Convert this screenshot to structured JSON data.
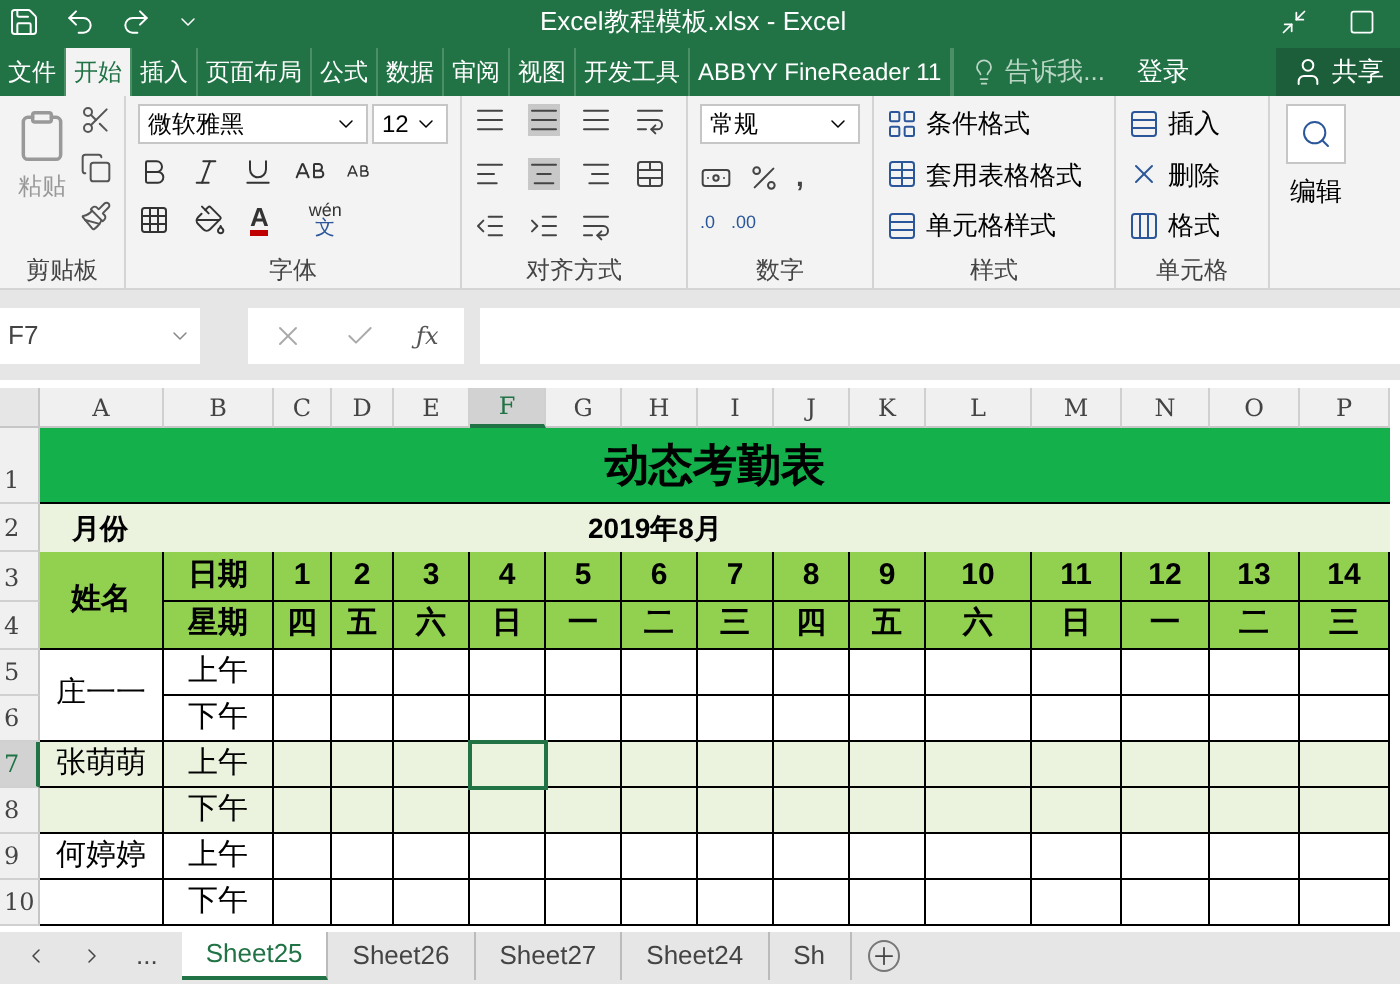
{
  "window": {
    "title": "Excel教程模板.xlsx - Excel"
  },
  "menu_tabs": [
    {
      "label": "文件",
      "selected": false
    },
    {
      "label": "开始",
      "selected": true
    },
    {
      "label": "插入",
      "selected": false
    },
    {
      "label": "页面布局",
      "selected": false
    },
    {
      "label": "公式",
      "selected": false
    },
    {
      "label": "数据",
      "selected": false
    },
    {
      "label": "审阅",
      "selected": false
    },
    {
      "label": "视图",
      "selected": false
    },
    {
      "label": "开发工具",
      "selected": false
    },
    {
      "label": "ABBYY FineReader 11",
      "selected": false
    }
  ],
  "tell_me": "告诉我...",
  "sign_in": "登录",
  "share": "共享",
  "ribbon": {
    "paste": "粘贴",
    "font_name": "微软雅黑",
    "font_size": "12",
    "phonetic": "wén",
    "phonetic_char": "文",
    "number_format": "常规",
    "comma": ",",
    "font_color_letter": "A",
    "function_label": "ƒx",
    "inc_decimal": ".0",
    "dec_decimal": ".00",
    "styles": [
      "条件格式",
      "套用表格格式",
      "单元格样式"
    ],
    "cells": [
      "插入",
      "删除",
      "格式"
    ],
    "editing": "编辑",
    "groups": [
      "剪贴板",
      "字体",
      "对齐方式",
      "数字",
      "样式",
      "单元格"
    ]
  },
  "name_box": "F7",
  "columns": [
    {
      "label": "A",
      "selected": false
    },
    {
      "label": "B",
      "selected": false
    },
    {
      "label": "C",
      "selected": false
    },
    {
      "label": "D",
      "selected": false
    },
    {
      "label": "E",
      "selected": false
    },
    {
      "label": "F",
      "selected": true
    },
    {
      "label": "G",
      "selected": false
    },
    {
      "label": "H",
      "selected": false
    },
    {
      "label": "I",
      "selected": false
    },
    {
      "label": "J",
      "selected": false
    },
    {
      "label": "K",
      "selected": false
    },
    {
      "label": "L",
      "selected": false
    },
    {
      "label": "M",
      "selected": false
    },
    {
      "label": "N",
      "selected": false
    },
    {
      "label": "O",
      "selected": false
    },
    {
      "label": "P",
      "selected": false
    }
  ],
  "rows": [
    {
      "label": "1",
      "selected": false
    },
    {
      "label": "2",
      "selected": false
    },
    {
      "label": "3",
      "selected": false
    },
    {
      "label": "4",
      "selected": false
    },
    {
      "label": "5",
      "selected": false
    },
    {
      "label": "6",
      "selected": false
    },
    {
      "label": "7",
      "selected": true
    },
    {
      "label": "8",
      "selected": false
    },
    {
      "label": "9",
      "selected": false
    },
    {
      "label": "10",
      "selected": false
    }
  ],
  "sheet": {
    "title": "动态考勤表",
    "month_label": "月份",
    "month_value": "2019年8月",
    "name_header": "姓名",
    "date_header": "日期",
    "weekday_header": "星期",
    "dates": [
      {
        "day": "1",
        "weekday": "四"
      },
      {
        "day": "2",
        "weekday": "五"
      },
      {
        "day": "3",
        "weekday": "六"
      },
      {
        "day": "4",
        "weekday": "日"
      },
      {
        "day": "5",
        "weekday": "一"
      },
      {
        "day": "6",
        "weekday": "二"
      },
      {
        "day": "7",
        "weekday": "三"
      },
      {
        "day": "8",
        "weekday": "四"
      },
      {
        "day": "9",
        "weekday": "五"
      },
      {
        "day": "10",
        "weekday": "六"
      },
      {
        "day": "11",
        "weekday": "日"
      },
      {
        "day": "12",
        "weekday": "一"
      },
      {
        "day": "13",
        "weekday": "二"
      },
      {
        "day": "14",
        "weekday": "三"
      }
    ],
    "people": [
      {
        "name": "庄一一",
        "merged": true,
        "shaded": false,
        "slots": [
          "上午",
          "下午"
        ]
      },
      {
        "name": "张萌萌",
        "merged": false,
        "shaded": true,
        "slots": [
          "上午",
          "下午"
        ]
      },
      {
        "name": "何婷婷",
        "merged": false,
        "shaded": false,
        "slots": [
          "上午",
          "下午"
        ]
      }
    ]
  },
  "sheet_tabs": [
    {
      "label": "Sheet25",
      "selected": true
    },
    {
      "label": "Sheet26",
      "selected": false
    },
    {
      "label": "Sheet27",
      "selected": false
    },
    {
      "label": "Sheet24",
      "selected": false
    },
    {
      "label": "Sh",
      "selected": false
    }
  ],
  "tab_overflow": "..."
}
